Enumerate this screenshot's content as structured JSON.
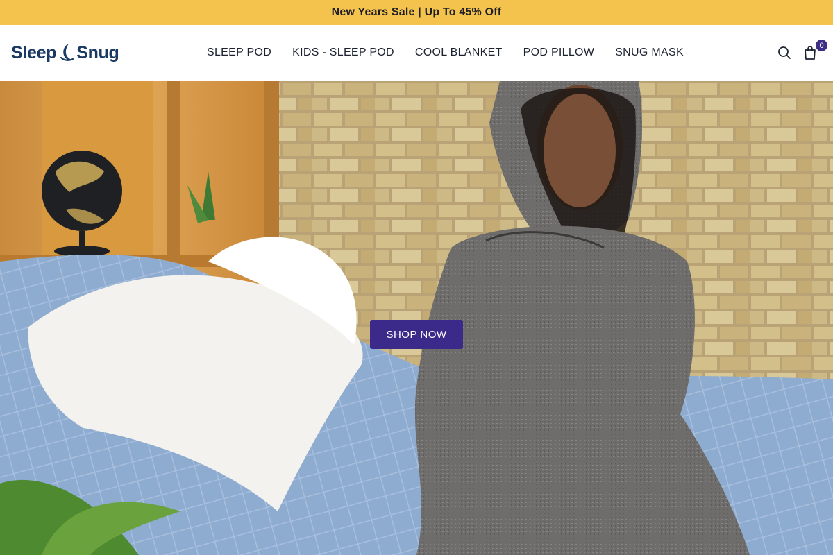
{
  "announcement": {
    "text": "New Years Sale | Up To 45% Off"
  },
  "header": {
    "logo": {
      "word_left": "Sleep",
      "word_right": "Snug",
      "icon": "crescent-moon-icon"
    },
    "nav": [
      {
        "label": "SLEEP POD"
      },
      {
        "label": "KIDS - SLEEP POD"
      },
      {
        "label": "COOL BLANKET"
      },
      {
        "label": "POD PILLOW"
      },
      {
        "label": "SNUG MASK"
      }
    ],
    "search_icon": "search-icon",
    "cart_icon": "shopping-bag-icon",
    "cart_count": "0"
  },
  "hero": {
    "cta_label": "SHOP NOW",
    "image": "woman-in-grey-hooded-sleep-pod-on-bed-with-pillows-and-blue-quilt"
  },
  "colors": {
    "announcement_bg": "#f4c34e",
    "brand_navy": "#1a3a63",
    "cta_purple": "#3b2a8a",
    "cart_badge": "#3e2e84"
  }
}
